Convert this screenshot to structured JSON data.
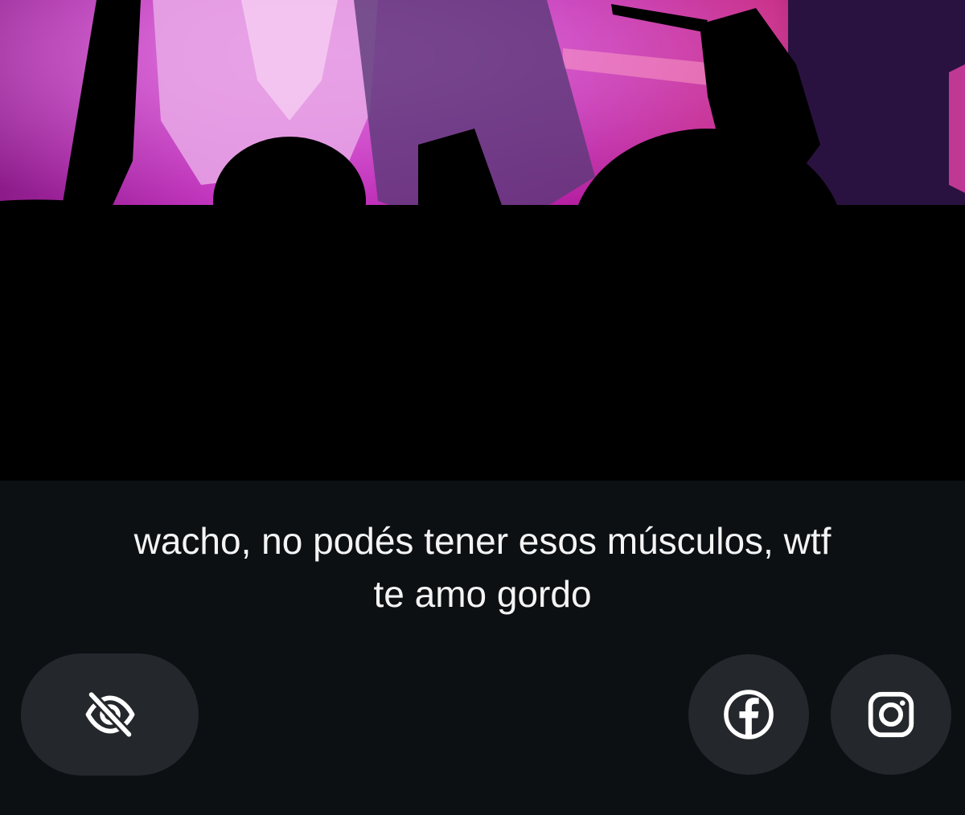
{
  "caption": {
    "line1": "wacho, no podés tener esos músculos, wtf",
    "line2": "te amo gordo"
  },
  "icons": {
    "hide": "eye-off-icon",
    "facebook": "facebook-icon",
    "instagram": "instagram-icon"
  },
  "colors": {
    "background": "#0d1013",
    "button": "#24282c",
    "text": "#f4f4f4",
    "stage_magenta": "#c21fb4"
  }
}
